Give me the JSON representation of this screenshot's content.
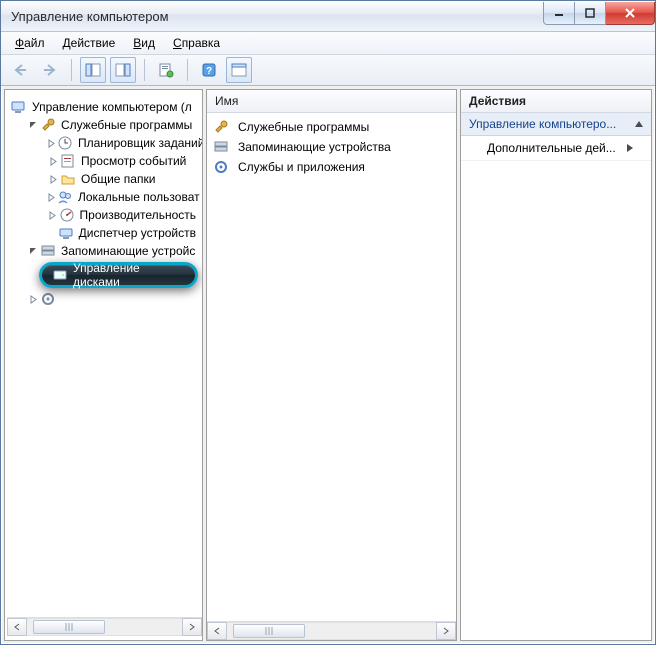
{
  "window": {
    "title": "Управление компьютером"
  },
  "menu": {
    "file": "Файл",
    "action": "Действие",
    "view": "Вид",
    "help": "Справка"
  },
  "tree": {
    "root": "Управление компьютером (л",
    "system_tools": "Служебные программы",
    "task_scheduler": "Планировщик заданий",
    "event_viewer": "Просмотр событий",
    "shared_folders": "Общие папки",
    "local_users": "Локальные пользоват",
    "performance": "Производительность",
    "device_manager": "Диспетчер устройств",
    "storage": "Запоминающие устройс",
    "disk_management": "Управление дисками"
  },
  "list": {
    "header": "Имя",
    "items": {
      "system_tools": "Служебные программы",
      "storage": "Запоминающие устройства",
      "services": "Службы и приложения"
    }
  },
  "actions": {
    "header": "Действия",
    "section": "Управление компьютеро...",
    "more": "Дополнительные дей..."
  }
}
